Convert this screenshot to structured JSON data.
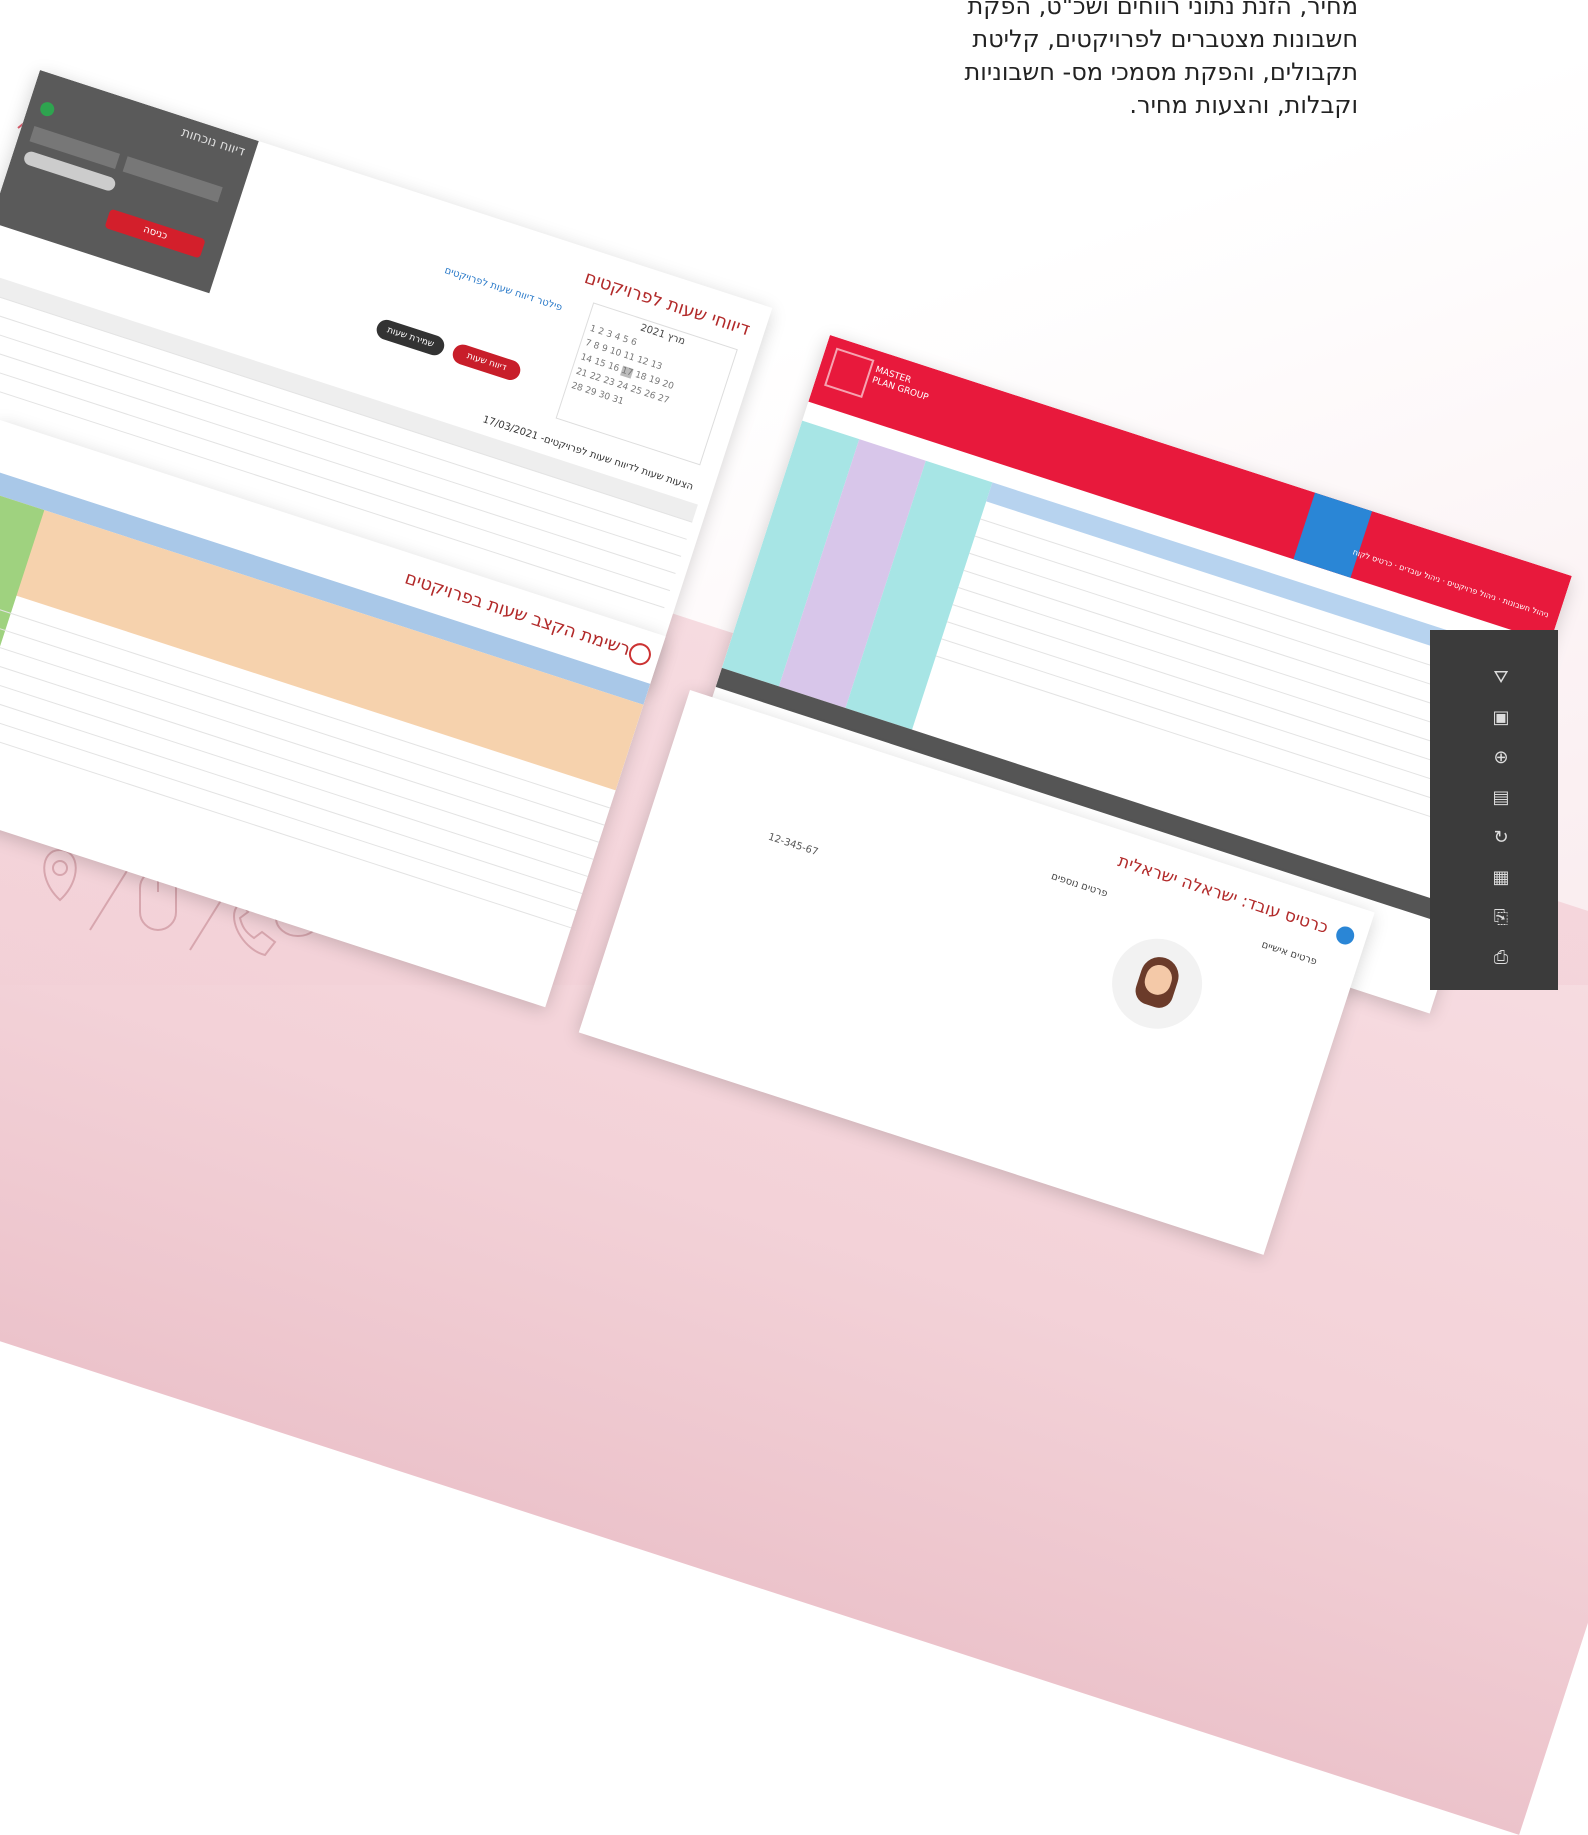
{
  "hero": {
    "lines": [
      "מחיר, הזנת נתוני רווחים ושכ\"ט, הפקת",
      "חשבונות מצטברים לפרויקטים, קליטת",
      "תקבולים, והפקת מסמכי מס- חשבוניות",
      "וקבלות, והצעות מחיר."
    ]
  },
  "shot1": {
    "title": "דיווחי שעות לפרויקטים",
    "header_title": "דיווח נוכחות",
    "start_label": "כניסה",
    "calendar_label": "מרץ 2021",
    "buttons": {
      "report": "דיווח שעות",
      "save": "שמירת שעות"
    },
    "section_title": "פילטר דיווח שעות לפרויקטים",
    "list_title": "הצעות שעות לדיווח שעות לפרויקטים- 17/03/2021"
  },
  "shot2": {
    "title": "רשימת הקצב שעות בפרויקטים"
  },
  "shot3": {
    "brand": "MASTER PLAN GROUP",
    "tabs": [
      "ניהול חשבונות",
      "ניהול פרויקטים",
      "ניהול עובדים",
      "כרטיס לקוח"
    ]
  },
  "shot4": {
    "title": "כרטיס עובד: ישראלה ישראלית",
    "section_personal": "פרטים אישיים",
    "section_more": "פרטים נוספים",
    "phone": "12-345-67"
  },
  "colors": {
    "accent_red": "#e8193c",
    "band_pink": "#f3d2d8",
    "title_red": "#b22a2a"
  }
}
